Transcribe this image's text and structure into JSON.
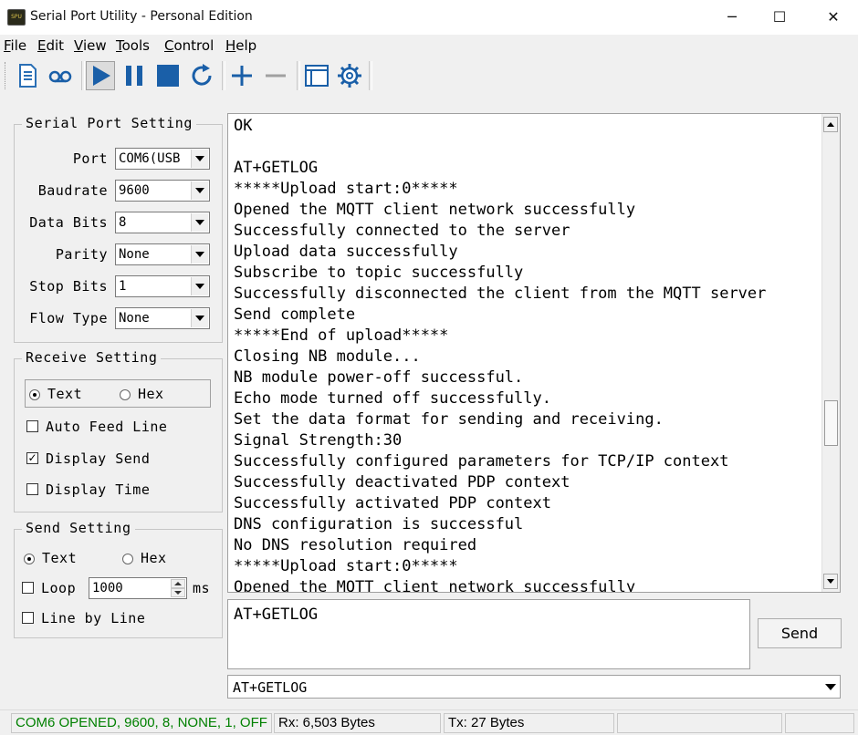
{
  "window": {
    "title": "Serial Port Utility - Personal Edition",
    "icon_text": "SPU",
    "minimize": "─",
    "maximize": "☐",
    "close": "✕"
  },
  "menu": [
    {
      "label": "File",
      "accel": "F",
      "rest": "ile"
    },
    {
      "label": "Edit",
      "accel": "E",
      "rest": "dit"
    },
    {
      "label": "View",
      "accel": "V",
      "rest": "iew"
    },
    {
      "label": "Tools",
      "accel": "T",
      "rest": "ools"
    },
    {
      "label": "Control",
      "accel": "C",
      "rest": "ontrol"
    },
    {
      "label": "Help",
      "accel": "H",
      "rest": "elp"
    }
  ],
  "toolbar_icons": [
    "document-icon",
    "record-icon",
    "play-icon",
    "pause-icon",
    "stop-icon",
    "refresh-icon",
    "plus-icon",
    "minus-icon",
    "window-icon",
    "gear-icon"
  ],
  "serial": {
    "title": "Serial Port Setting",
    "port_label": "Port",
    "port_value": "COM6(USB",
    "baud_label": "Baudrate",
    "baud_value": "9600",
    "databits_label": "Data Bits",
    "databits_value": "8",
    "parity_label": "Parity",
    "parity_value": "None",
    "stopbits_label": "Stop Bits",
    "stopbits_value": "1",
    "flow_label": "Flow Type",
    "flow_value": "None"
  },
  "receive": {
    "title": "Receive Setting",
    "text_label": "Text",
    "hex_label": "Hex",
    "mode": "Text",
    "auto_feed_label": "Auto Feed Line",
    "auto_feed": false,
    "display_send_label": "Display Send",
    "display_send": true,
    "display_time_label": "Display Time",
    "display_time": false
  },
  "send": {
    "title": "Send Setting",
    "text_label": "Text",
    "hex_label": "Hex",
    "mode": "Text",
    "loop_label": "Loop",
    "loop_checked": false,
    "loop_value": "1000",
    "ms_label": "ms",
    "line_by_line_label": "Line by Line",
    "line_by_line": false
  },
  "receive_lines": [
    "OK",
    "",
    "AT+GETLOG",
    "*****Upload start:0*****",
    "Opened the MQTT client network successfully",
    "Successfully connected to the server",
    "Upload data successfully",
    "Subscribe to topic successfully",
    "Successfully disconnected the client from the MQTT server",
    "Send complete",
    "*****End of upload*****",
    "Closing NB module...",
    "NB module power-off successful.",
    "Echo mode turned off successfully.",
    "Set the data format for sending and receiving.",
    "Signal Strength:30",
    "Successfully configured parameters for TCP/IP context",
    "Successfully deactivated PDP context",
    "Successfully activated PDP context",
    "DNS configuration is successful",
    "No DNS resolution required",
    "*****Upload start:0*****",
    "Opened the MQTT client network successfully"
  ],
  "send_text": "AT+GETLOG",
  "send_button": "Send",
  "history_value": "AT+GETLOG",
  "status": {
    "port_status": "COM6 OPENED, 9600, 8, NONE, 1, OFF",
    "port_status_color": "#008000",
    "rx": "Rx: 6,503 Bytes",
    "tx": "Tx: 27 Bytes"
  }
}
